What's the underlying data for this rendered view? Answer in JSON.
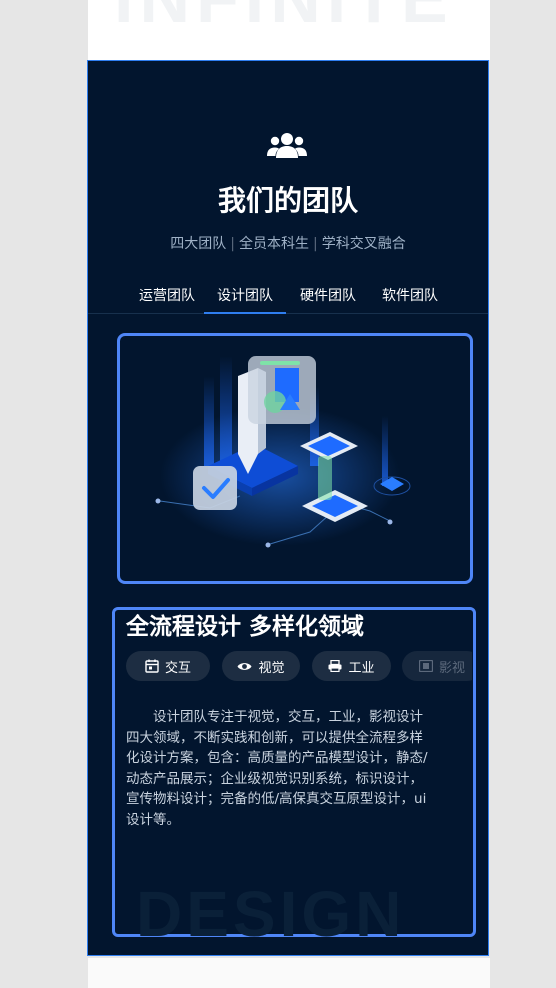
{
  "page": {
    "top_watermark": "INFINITE"
  },
  "team_section": {
    "title": "我们的团队",
    "subtitle_parts": [
      "四大团队",
      "全员本科生",
      "学科交叉融合"
    ],
    "subtitle_separator": "|",
    "tabs": [
      {
        "label": "运营团队",
        "active": false
      },
      {
        "label": "设计团队",
        "active": true
      },
      {
        "label": "硬件团队",
        "active": false
      },
      {
        "label": "软件团队",
        "active": false
      }
    ]
  },
  "content": {
    "heading": "全流程设计 多样化领域",
    "chips": [
      {
        "label": "交互",
        "icon": "calendar-icon"
      },
      {
        "label": "视觉",
        "icon": "eye-icon"
      },
      {
        "label": "工业",
        "icon": "printer-icon"
      },
      {
        "label": "影视",
        "icon": "film-icon"
      }
    ],
    "description": "设计团队专注于视觉，交互，工业，影视设计四大领域，不断实践和创新，可以提供全流程多样化设计方案，包含：高质量的产品模型设计，静态/动态产品展示；企业级视觉识别系统，标识设计，宣传物料设计；完备的低/高保真交互原型设计，ui设计等。",
    "bottom_watermark": "DESIGN"
  },
  "colors": {
    "panel_bg": "#02152e",
    "accent": "#2f7ef0",
    "highlight_border": "#4f86f7",
    "chip_bg": "#1d2d42"
  }
}
